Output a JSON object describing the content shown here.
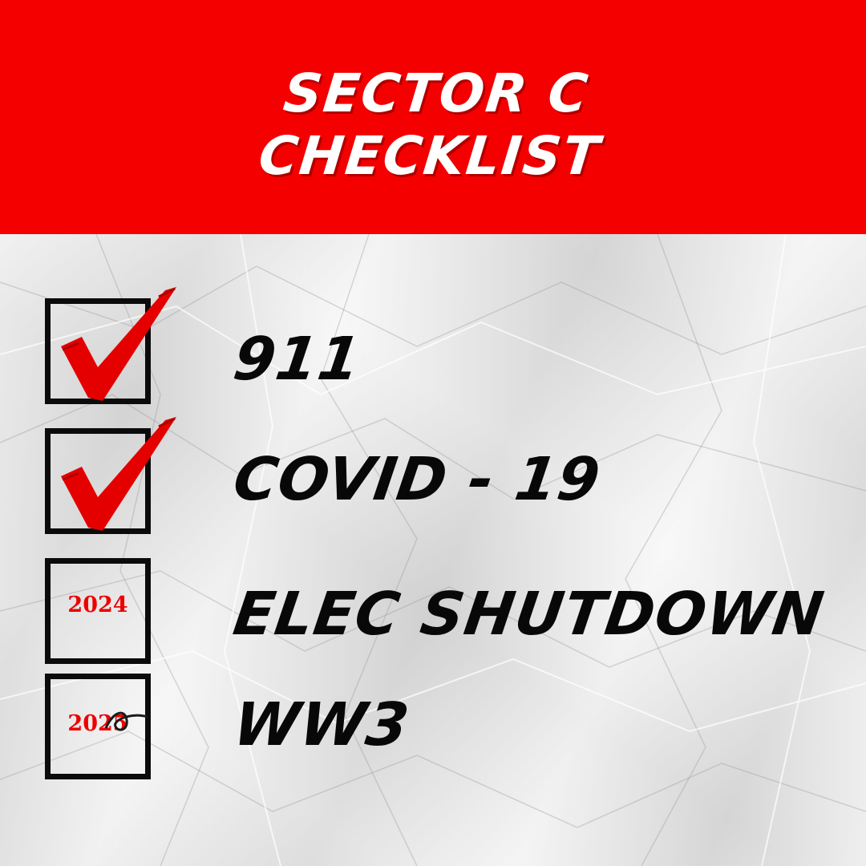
{
  "header": {
    "title_line1": "SECTOR C",
    "title_line2": "CHECKLIST",
    "background_color": "#f40000"
  },
  "checklist": [
    {
      "label": "911",
      "checked": true,
      "year": ""
    },
    {
      "label": "COVID  -  19",
      "checked": true,
      "year": ""
    },
    {
      "label": "ELEC SHUTDOWN",
      "checked": false,
      "year": "2024"
    },
    {
      "label": "WW3",
      "checked": false,
      "year": "2025"
    }
  ],
  "colors": {
    "check_mark": "#e50000",
    "text": "#080808",
    "year": "#ee0000"
  },
  "icons": {
    "check": "check-mark-icon",
    "checkbox": "checkbox-icon"
  }
}
